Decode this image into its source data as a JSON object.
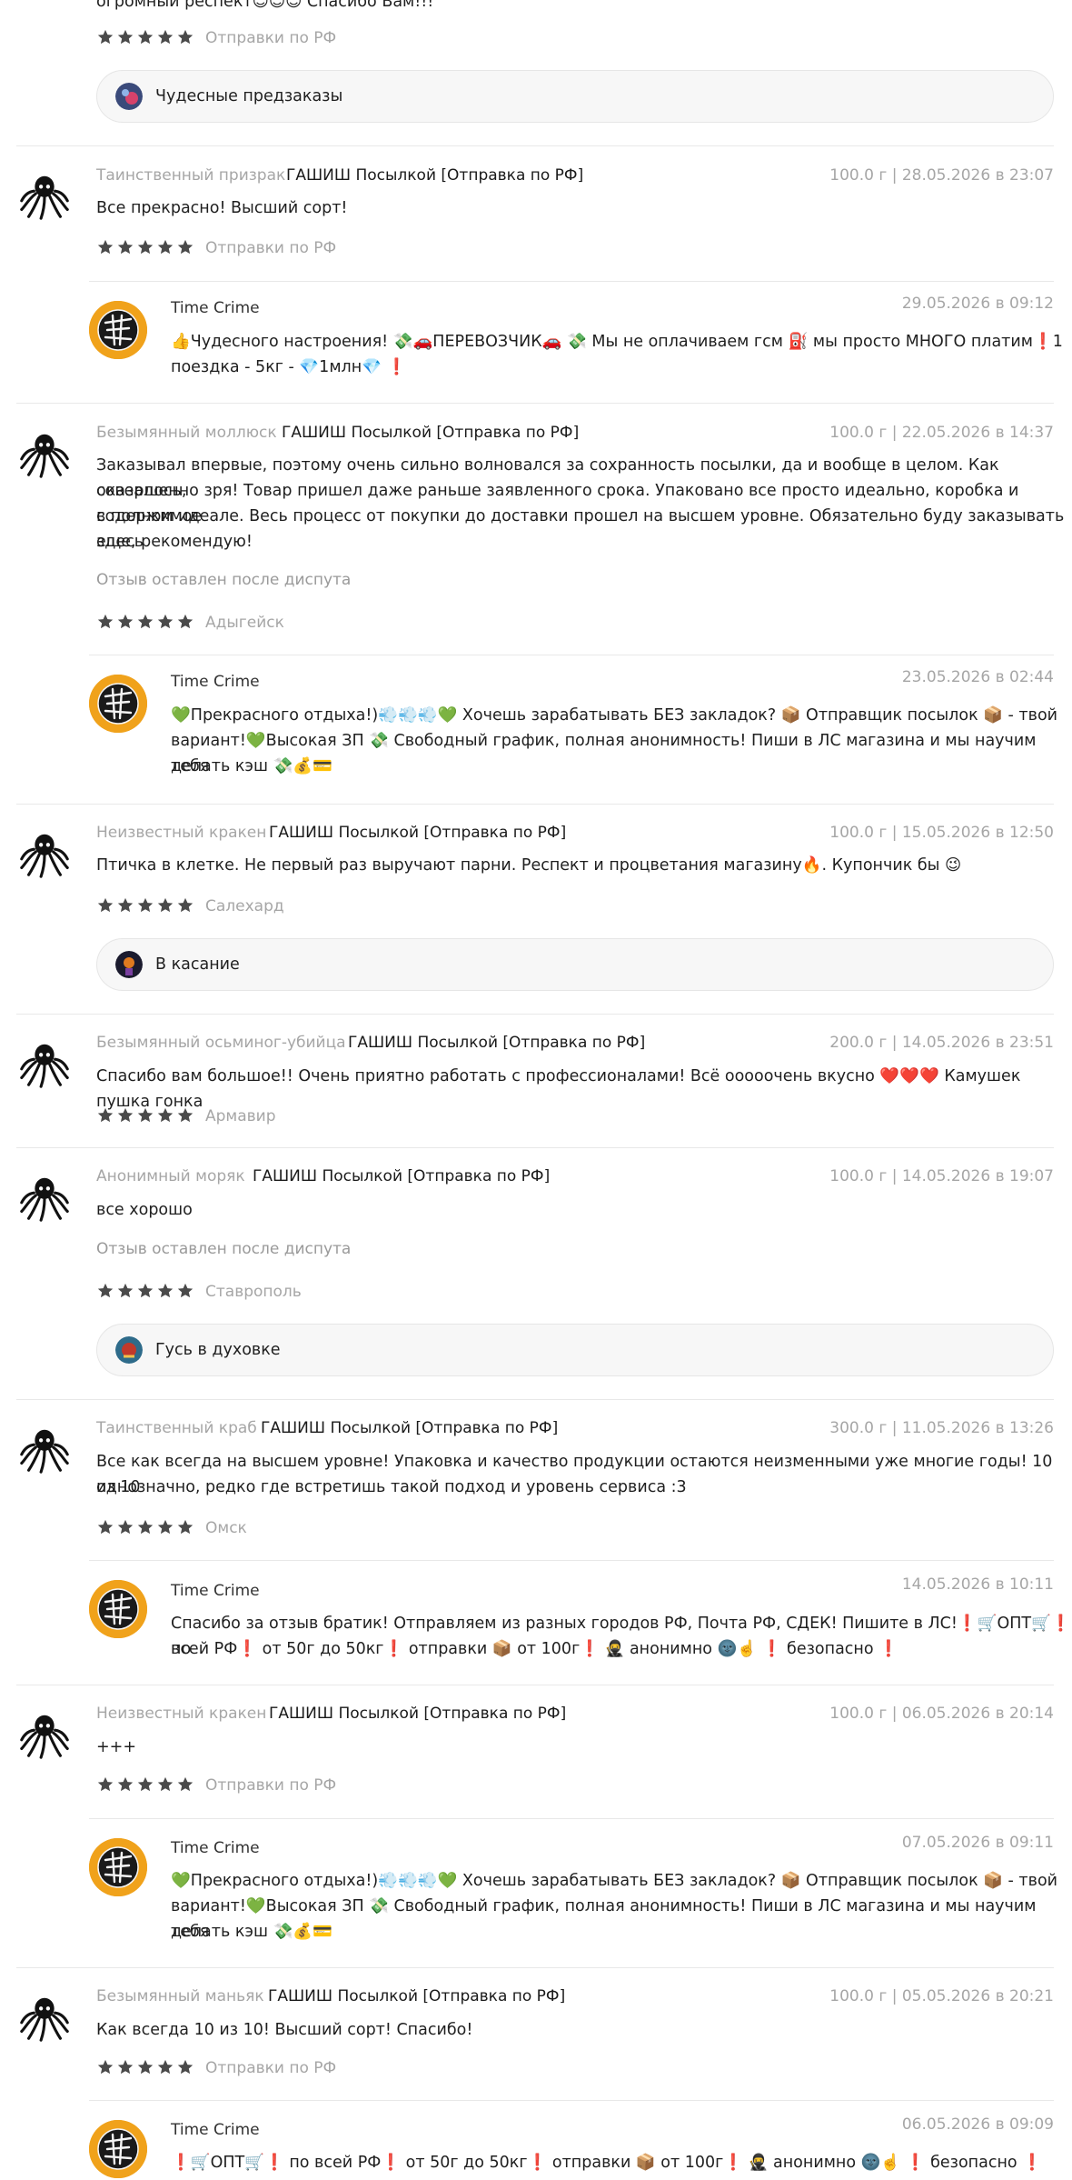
{
  "top": {
    "partial_text": "огромный респект😊😊😊 Спасибо Вам!!!",
    "city": "Отправки по РФ",
    "pill_label": "Чудесные предзаказы"
  },
  "reviews": [
    {
      "author": "Таинственный призрак",
      "product": "ГАШИШ Посылкой [Отправка по РФ]",
      "meta": "100.0 г | 28.05.2026 в 23:07",
      "text": "Все прекрасно! Высший сорт!",
      "city": "Отправки по РФ",
      "reply": {
        "name": "Time Crime",
        "date": "29.05.2026 в 09:12",
        "text_1": "👍Чудесного настроения! 💸🚗ПЕРЕВОЗЧИК🚗 💸 Мы не оплачиваем гсм ⛽ мы просто МНОГО платим❗1",
        "text_2": "поездка - 5кг - 💎1млн💎 ❗"
      }
    },
    {
      "author": "Безымянный моллюск",
      "product": "ГАШИШ Посылкой [Отправка по РФ]",
      "meta": "100.0 г | 22.05.2026 в 14:37",
      "text_1": "Заказывал впервые, поэтому очень сильно волновался за сохранность посылки, да и вообще в целом. Как оказалось,",
      "text_2": "совершенно зря! Товар пришел даже раньше заявленного срока. Упаковано все просто идеально, коробка и содержимое",
      "text_3": "в полном идеале. Весь процесс от покупки до доставки прошел на высшем уровне. Обязательно буду заказывать здесь",
      "text_4": "еще, рекомендую!",
      "note": "Отзыв оставлен после диспута",
      "city": "Адыгейск",
      "reply": {
        "name": "Time Crime",
        "date": "23.05.2026 в 02:44",
        "text_1": "💚Прекрасного отдыха!)💨💨💨💚 Хочешь зарабатывать БЕЗ закладок? 📦 Отправщик посылок 📦 - твой",
        "text_2": "вариант!💚Высокая ЗП 💸 Свободный график, полная анонимность! Пиши в ЛС магазина и мы научим тебя",
        "text_3": "делать кэш 💸💰💳"
      }
    },
    {
      "author": "Неизвестный кракен",
      "product": "ГАШИШ Посылкой [Отправка по РФ]",
      "meta": "100.0 г | 15.05.2026 в 12:50",
      "text": "Птичка в клетке. Не первый раз выручают парни. Респект и процветания магазину🔥. Купончик бы 😉",
      "city": "Салехард",
      "pill_label": "В касание"
    },
    {
      "author": "Безымянный осьминог-убийца",
      "product": "ГАШИШ Посылкой [Отправка по РФ]",
      "meta": "200.0 г | 14.05.2026 в 23:51",
      "text": "Спасибо вам большое!! Очень приятно работать с профессионалами! Всё ооооочень вкусно ❤️❤️❤️ Камушек пушка гонка",
      "city": "Армавир"
    },
    {
      "author": "Анонимный моряк",
      "product": "ГАШИШ Посылкой [Отправка по РФ]",
      "meta": "100.0 г | 14.05.2026 в 19:07",
      "text": "все хорошо",
      "note": "Отзыв оставлен после диспута",
      "city": "Ставрополь",
      "pill_label": "Гусь в духовке"
    },
    {
      "author": "Таинственный краб",
      "product": "ГАШИШ Посылкой [Отправка по РФ]",
      "meta": "300.0 г | 11.05.2026 в 13:26",
      "text_1": "Все как всегда на высшем уровне! Упаковка и качество продукции остаются неизменными уже многие годы! 10 из 10",
      "text_2": "однозначно, редко где встретишь такой подход и уровень сервиса :3",
      "city": "Омск",
      "reply": {
        "name": "Time Crime",
        "date": "14.05.2026 в 10:11",
        "text_1": "Спасибо за отзыв братик! Отправляем из разных городов РФ, Почта РФ, СДЕК! Пишите в ЛС!❗🛒ОПТ🛒❗ по",
        "text_2": "всей РФ❗ от 50г до 50кг❗ отправки 📦 от 100г❗ 🥷 анонимно 🌚☝️ ❗ безопасно ❗"
      }
    },
    {
      "author": "Неизвестный кракен",
      "product": "ГАШИШ Посылкой [Отправка по РФ]",
      "meta": "100.0 г | 06.05.2026 в 20:14",
      "text": "+++",
      "city": "Отправки по РФ",
      "reply": {
        "name": "Time Crime",
        "date": "07.05.2026 в 09:11",
        "text_1": "💚Прекрасного отдыха!)💨💨💨💚 Хочешь зарабатывать БЕЗ закладок? 📦 Отправщик посылок 📦 - твой",
        "text_2": "вариант!💚Высокая ЗП 💸 Свободный график, полная анонимность! Пиши в ЛС магазина и мы научим тебя",
        "text_3": "делать кэш 💸💰💳"
      }
    },
    {
      "author": "Безымянный маньяк",
      "product": "ГАШИШ Посылкой [Отправка по РФ]",
      "meta": "100.0 г | 05.05.2026 в 20:21",
      "text": "Как всегда 10 из 10! Высший сорт! Спасибо!",
      "city": "Отправки по РФ",
      "reply": {
        "name": "Time Crime",
        "date": "06.05.2026 в 09:09",
        "text_1": "❗🛒ОПТ🛒❗ по всей РФ❗ от 50г до 50кг❗ отправки 📦 от 100г❗ 🥷 анонимно 🌚☝️ ❗ безопасно ❗"
      }
    }
  ],
  "icons": {
    "star": "star-icon",
    "octopus": "octopus-avatar-icon",
    "shop": "shop-logo-icon"
  },
  "colors": {
    "star": "#4a4a4a",
    "shop_avatar": "#f0a21b",
    "muted": "#a6a6a6"
  }
}
